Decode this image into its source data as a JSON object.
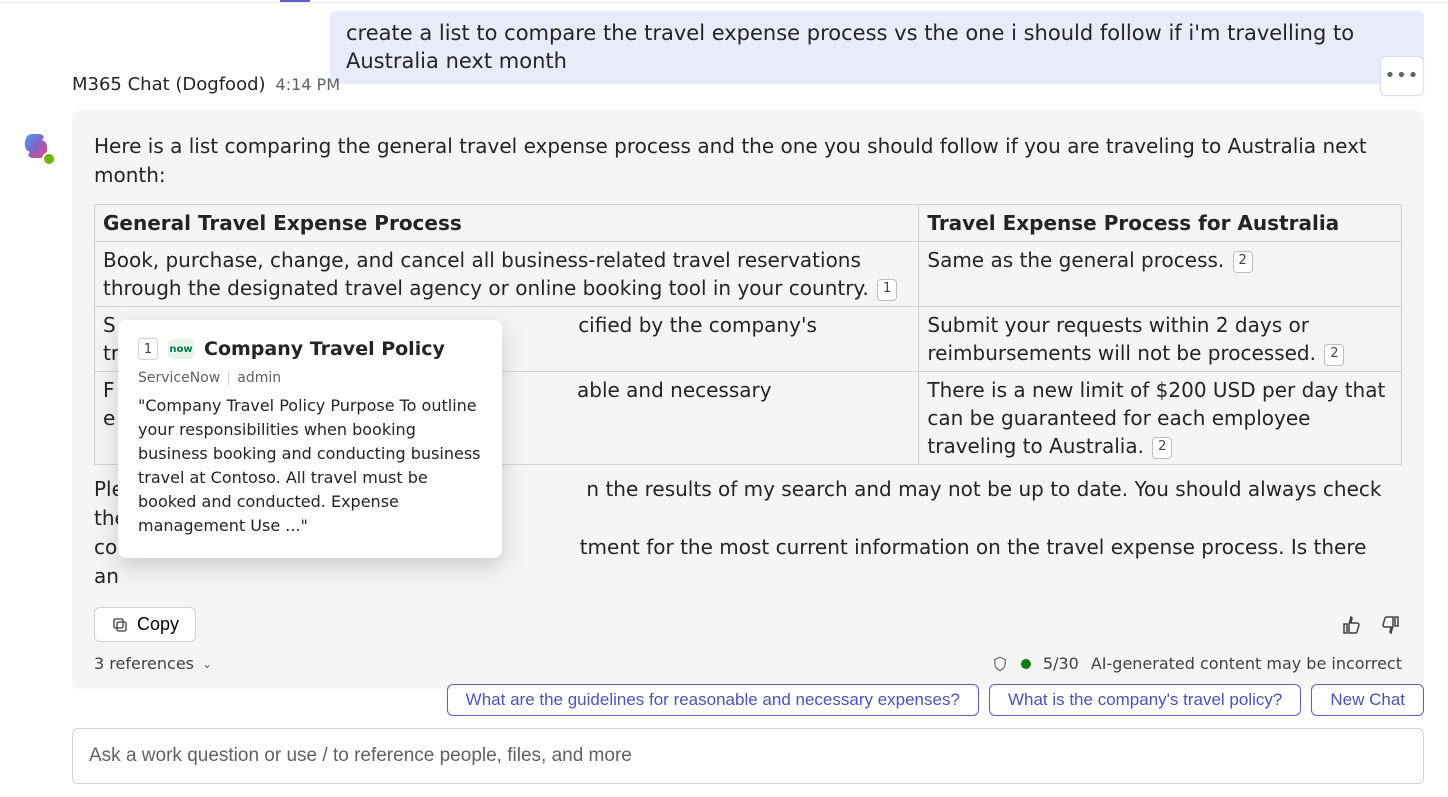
{
  "user_message": "create a list to compare the travel expense process vs the one i should follow if i'm travelling to Australia next month",
  "sender": "M365 Chat (Dogfood)",
  "timestamp": "4:14 PM",
  "intro": "Here is a list comparing the general travel expense process and the one you should follow if you are traveling to Australia next month:",
  "table": {
    "headers": {
      "left": "General Travel Expense Process",
      "right": "Travel Expense Process for Australia"
    },
    "rows": [
      {
        "left": "Book, purchase, change, and cancel all business-related travel reservations through the designated travel agency or online booking tool in your country.",
        "left_ref": "1",
        "right": "Same as the general process.",
        "right_ref": "2"
      },
      {
        "left_prefix": "S",
        "left_suffix": "cified by the company's",
        "right": "Submit your requests within 2 days or reimbursements will not be processed.",
        "right_ref": "2"
      },
      {
        "left_prefix": "F",
        "left_suffix": "able and necessary",
        "right": "There is a new limit of $200 USD per day that can be guaranteed for each employee traveling to Australia.",
        "right_ref": "2"
      }
    ],
    "row2_line2": "tr",
    "row3_line2": "e"
  },
  "outro_prefix": "Ple",
  "outro_line1_suffix": "n the results of my search and may not be up to date. You should always check the",
  "outro_line2_prefix": "co",
  "outro_line2_suffix": "tment for the most current information on the travel expense process. Is there",
  "outro_line3": "an",
  "copy_label": "Copy",
  "references_label": "3 references",
  "ai_counter": "5/30",
  "ai_disclaimer": "AI-generated content may be incorrect",
  "suggestions": [
    "What are the guidelines for reasonable and necessary expenses?",
    "What is the company's travel policy?",
    "New Chat"
  ],
  "compose_placeholder": "Ask a work question or use / to reference people, files, and more",
  "ref_popup": {
    "num": "1",
    "source_icon_text": "now",
    "title": "Company Travel Policy",
    "source": "ServiceNow",
    "author": "admin",
    "snippet": "\"Company Travel Policy Purpose To outline your responsibilities when booking business booking and conducting business travel at Contoso. All travel must be booked and conducted. Expense management Use ...\""
  }
}
